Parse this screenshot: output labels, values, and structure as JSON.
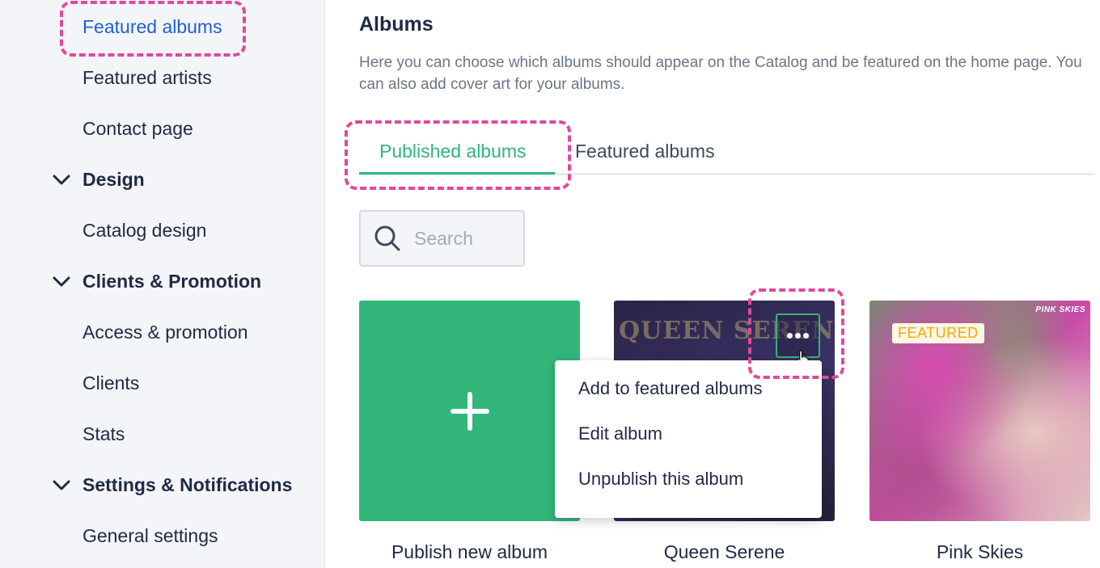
{
  "sidebar": {
    "items": [
      {
        "label": "Featured albums",
        "active": true
      },
      {
        "label": "Featured artists"
      },
      {
        "label": "Contact page"
      }
    ],
    "sections": [
      {
        "label": "Design",
        "icon": "chevron-down-icon",
        "items": [
          {
            "label": "Catalog design"
          }
        ]
      },
      {
        "label": "Clients & Promotion",
        "icon": "chevron-down-icon",
        "items": [
          {
            "label": "Access & promotion"
          },
          {
            "label": "Clients"
          },
          {
            "label": "Stats"
          }
        ]
      },
      {
        "label": "Settings & Notifications",
        "icon": "chevron-down-icon",
        "items": [
          {
            "label": "General settings"
          }
        ]
      }
    ]
  },
  "main": {
    "title": "Albums",
    "description": "Here you can choose which albums should appear on the Catalog and be featured on the home page. You can also add cover art for your albums.",
    "tabs": [
      {
        "label": "Published albums",
        "active": true
      },
      {
        "label": "Featured albums"
      }
    ],
    "search": {
      "placeholder": "Search",
      "value": "",
      "icon": "search-icon"
    },
    "albums": [
      {
        "label": "Publish new album",
        "icon": "plus-icon"
      },
      {
        "label": "Queen Serene",
        "cover_text": "QUEEN SERENE"
      },
      {
        "label": "Pink Skies",
        "badge": "FEATURED",
        "cover_text": "PINK SKIES"
      }
    ],
    "context_menu": {
      "items": [
        "Add to featured albums",
        "Edit album",
        "Unpublish this album"
      ]
    }
  },
  "colors": {
    "accent_green": "#32b67a",
    "active_link": "#1f5fd6",
    "highlight": "#e0489b",
    "featured_badge": "#f2a900"
  }
}
